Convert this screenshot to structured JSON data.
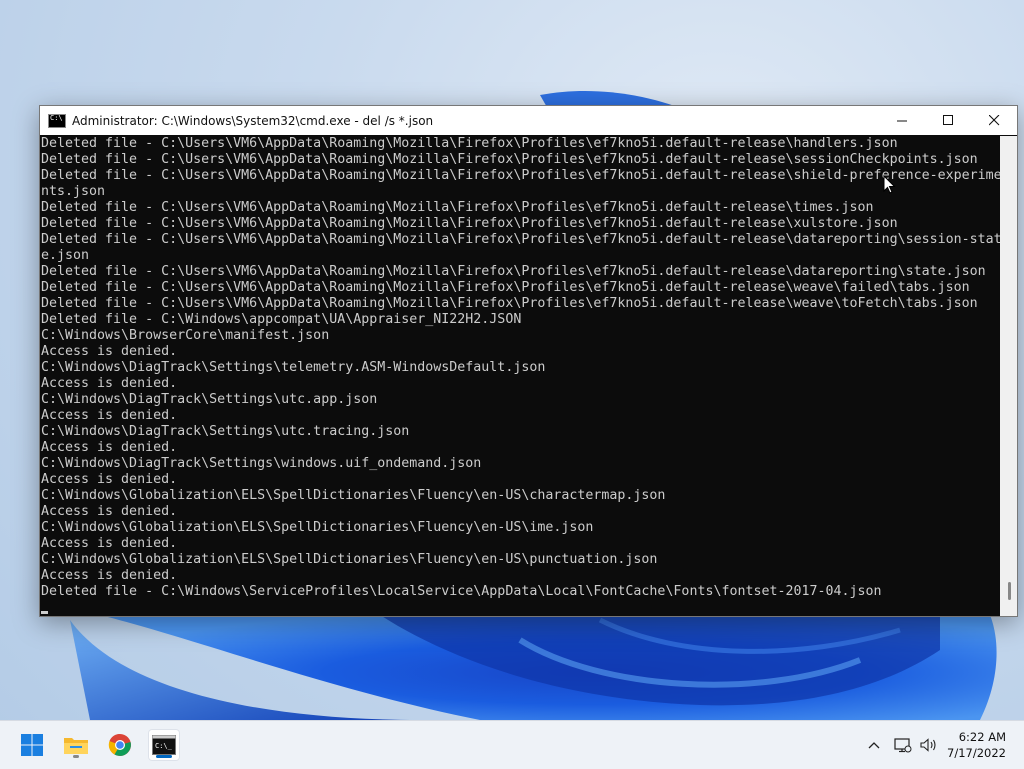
{
  "window": {
    "title": "Administrator: C:\\Windows\\System32\\cmd.exe - del  /s *.json",
    "minimize_label": "—",
    "maximize_label": "☐",
    "close_label": "✕"
  },
  "console": {
    "lines": [
      "Deleted file - C:\\Users\\VM6\\AppData\\Roaming\\Mozilla\\Firefox\\Profiles\\ef7kno5i.default-release\\handlers.json",
      "Deleted file - C:\\Users\\VM6\\AppData\\Roaming\\Mozilla\\Firefox\\Profiles\\ef7kno5i.default-release\\sessionCheckpoints.json",
      "Deleted file - C:\\Users\\VM6\\AppData\\Roaming\\Mozilla\\Firefox\\Profiles\\ef7kno5i.default-release\\shield-preference-experime",
      "nts.json",
      "Deleted file - C:\\Users\\VM6\\AppData\\Roaming\\Mozilla\\Firefox\\Profiles\\ef7kno5i.default-release\\times.json",
      "Deleted file - C:\\Users\\VM6\\AppData\\Roaming\\Mozilla\\Firefox\\Profiles\\ef7kno5i.default-release\\xulstore.json",
      "Deleted file - C:\\Users\\VM6\\AppData\\Roaming\\Mozilla\\Firefox\\Profiles\\ef7kno5i.default-release\\datareporting\\session-stat",
      "e.json",
      "Deleted file - C:\\Users\\VM6\\AppData\\Roaming\\Mozilla\\Firefox\\Profiles\\ef7kno5i.default-release\\datareporting\\state.json",
      "Deleted file - C:\\Users\\VM6\\AppData\\Roaming\\Mozilla\\Firefox\\Profiles\\ef7kno5i.default-release\\weave\\failed\\tabs.json",
      "Deleted file - C:\\Users\\VM6\\AppData\\Roaming\\Mozilla\\Firefox\\Profiles\\ef7kno5i.default-release\\weave\\toFetch\\tabs.json",
      "Deleted file - C:\\Windows\\appcompat\\UA\\Appraiser_NI22H2.JSON",
      "C:\\Windows\\BrowserCore\\manifest.json",
      "Access is denied.",
      "C:\\Windows\\DiagTrack\\Settings\\telemetry.ASM-WindowsDefault.json",
      "Access is denied.",
      "C:\\Windows\\DiagTrack\\Settings\\utc.app.json",
      "Access is denied.",
      "C:\\Windows\\DiagTrack\\Settings\\utc.tracing.json",
      "Access is denied.",
      "C:\\Windows\\DiagTrack\\Settings\\windows.uif_ondemand.json",
      "Access is denied.",
      "C:\\Windows\\Globalization\\ELS\\SpellDictionaries\\Fluency\\en-US\\charactermap.json",
      "Access is denied.",
      "C:\\Windows\\Globalization\\ELS\\SpellDictionaries\\Fluency\\en-US\\ime.json",
      "Access is denied.",
      "C:\\Windows\\Globalization\\ELS\\SpellDictionaries\\Fluency\\en-US\\punctuation.json",
      "Access is denied.",
      "Deleted file - C:\\Windows\\ServiceProfiles\\LocalService\\AppData\\Local\\FontCache\\Fonts\\fontset-2017-04.json"
    ]
  },
  "taskbar": {
    "icons": [
      {
        "name": "start-icon",
        "active": false
      },
      {
        "name": "file-explorer-icon",
        "active": false
      },
      {
        "name": "chrome-icon",
        "active": false
      },
      {
        "name": "command-prompt-icon",
        "active": true
      }
    ]
  },
  "tray": {
    "chevron": "^",
    "time": "6:22 AM",
    "date": "7/17/2022"
  },
  "colors": {
    "console_bg": "#0c0c0c",
    "console_fg": "#cccccc",
    "accent": "#0067c0",
    "wallpaper_blue": "#1d5bd8"
  }
}
